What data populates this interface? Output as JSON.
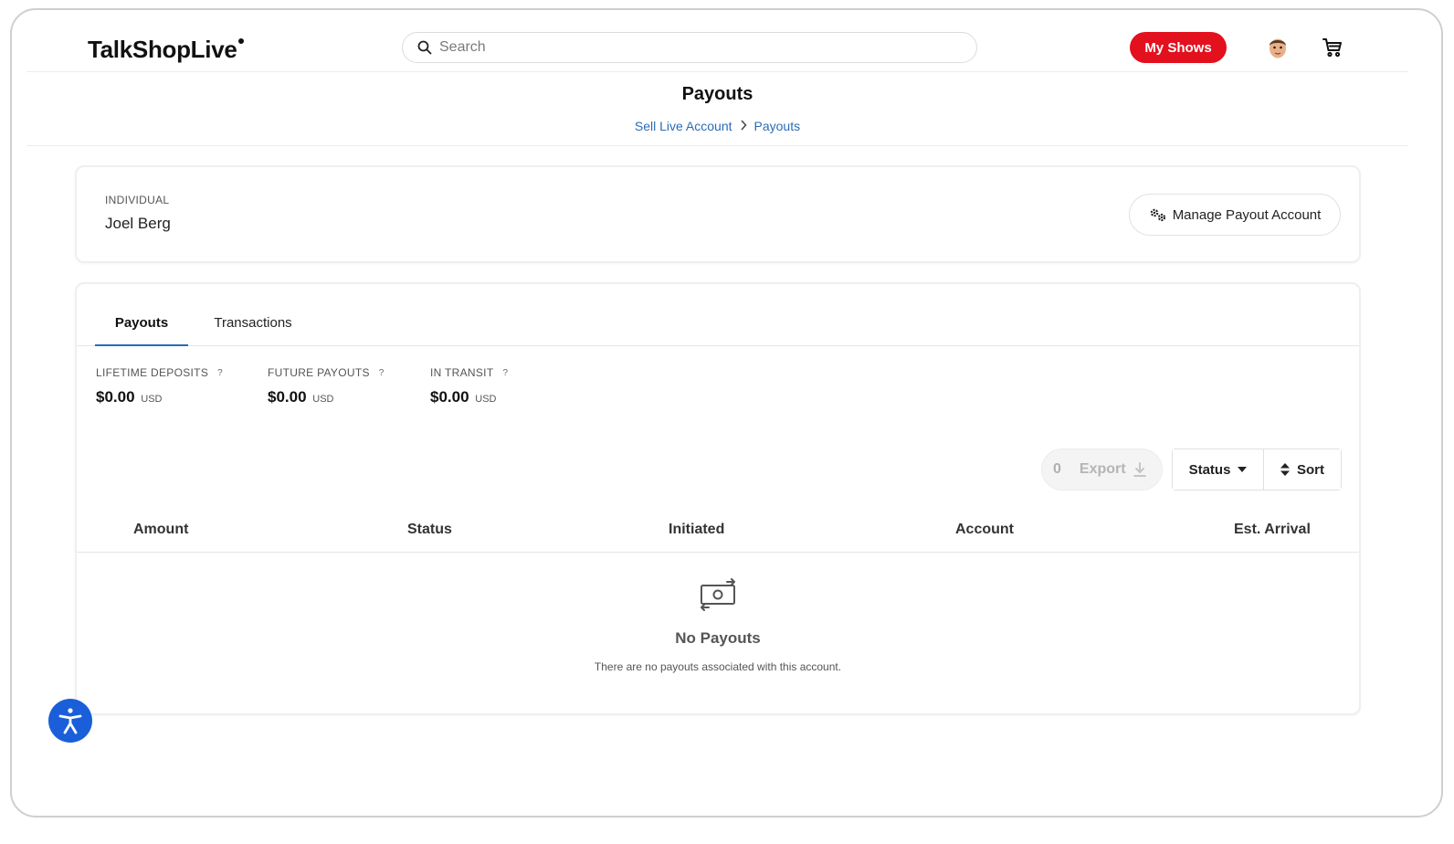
{
  "header": {
    "logo": "TalkShopLive",
    "search_placeholder": "Search",
    "my_shows_label": "My Shows",
    "brand_red": "#e3101e"
  },
  "page": {
    "title": "Payouts",
    "breadcrumb": [
      "Sell Live Account",
      "Payouts"
    ]
  },
  "account": {
    "type": "INDIVIDUAL",
    "name": "Joel Berg",
    "manage_label": "Manage Payout Account"
  },
  "tabs": [
    {
      "label": "Payouts",
      "active": true
    },
    {
      "label": "Transactions",
      "active": false
    }
  ],
  "stats": [
    {
      "label": "LIFETIME DEPOSITS",
      "help": "?",
      "value": "$0.00",
      "currency": "USD"
    },
    {
      "label": "FUTURE PAYOUTS",
      "help": "?",
      "value": "$0.00",
      "currency": "USD"
    },
    {
      "label": "IN TRANSIT",
      "help": "?",
      "value": "$0.00",
      "currency": "USD"
    }
  ],
  "toolbar": {
    "export_count": "0",
    "export_label": "Export",
    "status_label": "Status",
    "sort_label": "Sort"
  },
  "table": {
    "columns": [
      "Amount",
      "Status",
      "Initiated",
      "Account",
      "Est. Arrival"
    ]
  },
  "empty": {
    "title": "No Payouts",
    "subtitle": "There are no payouts associated with this account."
  },
  "accent_color": "#2a6cb5",
  "a11y_color": "#1a5fd9"
}
